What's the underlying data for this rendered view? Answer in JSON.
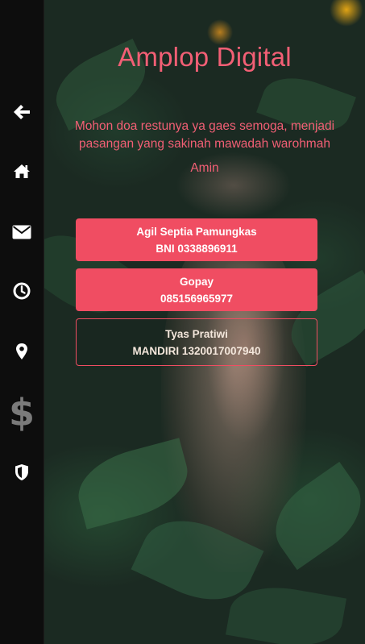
{
  "sidebar": {
    "items": [
      {
        "icon": "arrow-left-icon",
        "color": "#ffffff"
      },
      {
        "icon": "home-icon",
        "color": "#ffffff"
      },
      {
        "icon": "envelope-icon",
        "color": "#ffffff"
      },
      {
        "icon": "clock-icon",
        "color": "#ffffff"
      },
      {
        "icon": "map-marker-icon",
        "color": "#ffffff"
      },
      {
        "icon": "dollar-icon",
        "color": "#7a7a7a"
      },
      {
        "icon": "shield-icon",
        "color": "#ffffff"
      }
    ]
  },
  "main": {
    "title": "Amplop Digital",
    "message": "Mohon doa restunya ya gaes semoga, menjadi pasangan yang sakinah mawadah warohmah",
    "amin": "Amin",
    "accent_color": "#f04d62",
    "cards": [
      {
        "name": "Agil Septia Pamungkas",
        "account": "BNI 0338896911",
        "style": "filled"
      },
      {
        "name": "Gopay",
        "account": "085156965977",
        "style": "filled"
      },
      {
        "name": "Tyas Pratiwi",
        "account": "MANDIRI 1320017007940",
        "style": "outline"
      }
    ]
  }
}
